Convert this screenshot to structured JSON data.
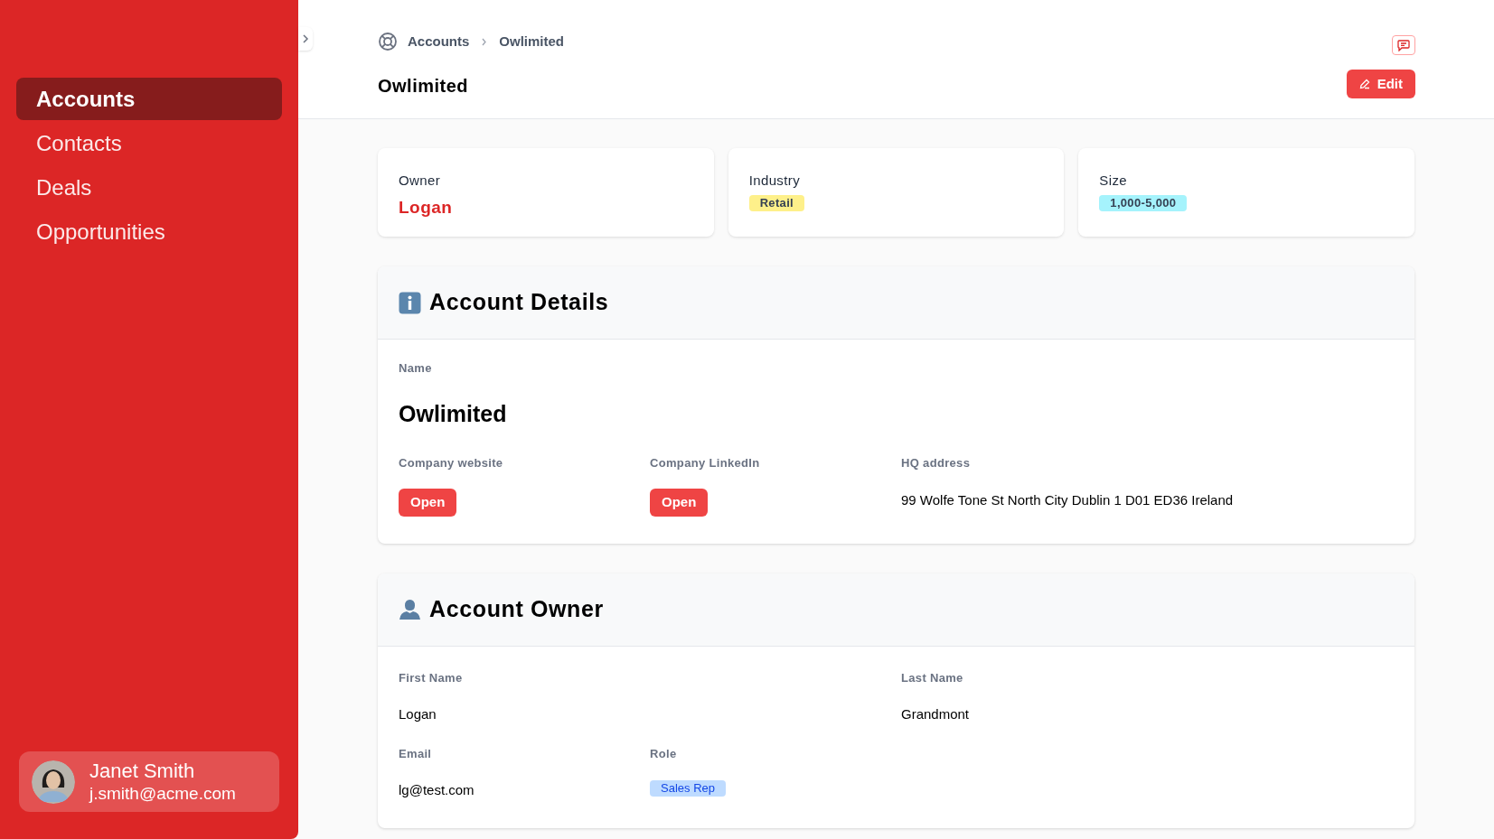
{
  "sidebar": {
    "items": [
      {
        "label": "Accounts",
        "selected": true
      },
      {
        "label": "Contacts",
        "selected": false
      },
      {
        "label": "Deals",
        "selected": false
      },
      {
        "label": "Opportunities",
        "selected": false
      }
    ],
    "user": {
      "name": "Janet Smith",
      "email": "j.smith@acme.com"
    }
  },
  "breadcrumb": [
    "Accounts",
    "Owlimited"
  ],
  "title": "Owlimited",
  "edit_button": "Edit",
  "summary_cards": [
    {
      "label": "Owner",
      "kind": "link",
      "value": "Logan"
    },
    {
      "label": "Industry",
      "kind": "badge",
      "value": "Retail",
      "color": "#fef08a"
    },
    {
      "label": "Size",
      "kind": "badge",
      "value": "1,000-5,000",
      "color": "#a5f3fc"
    }
  ],
  "sections": [
    {
      "kind": "details",
      "title": "Account Details",
      "rows": [
        [
          {
            "label": "Name",
            "kind": "large",
            "value": "Owlimited"
          }
        ],
        [
          {
            "label": "Company website",
            "kind": "button",
            "value": "Open"
          },
          {
            "label": "Company LinkedIn",
            "kind": "button",
            "value": "Open"
          },
          {
            "label": "HQ address",
            "kind": "text",
            "value": "99 Wolfe Tone St North City Dublin 1 D01 ED36 Ireland"
          }
        ]
      ]
    },
    {
      "kind": "owner",
      "title": "Account Owner",
      "rows": [
        [
          {
            "label": "First Name",
            "kind": "text",
            "value": "Logan"
          },
          {
            "label": "Last Name",
            "kind": "text",
            "value": "Grandmont"
          }
        ],
        [
          {
            "label": "Email",
            "kind": "text",
            "value": "lg@test.com"
          },
          {
            "label": "Role",
            "kind": "badge",
            "value": "Sales Rep"
          }
        ]
      ]
    }
  ]
}
